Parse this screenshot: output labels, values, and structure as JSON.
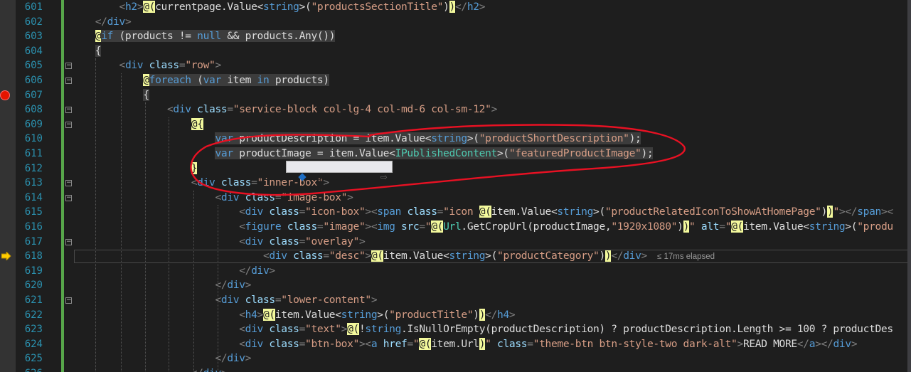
{
  "editor": {
    "line_numbers": [
      "601",
      "602",
      "603",
      "604",
      "605",
      "606",
      "607",
      "608",
      "609",
      "610",
      "611",
      "612",
      "613",
      "614",
      "615",
      "616",
      "617",
      "618",
      "619",
      "620",
      "621",
      "622",
      "623",
      "624",
      "625",
      "626"
    ],
    "lines": [
      [
        {
          "c": "t",
          "s": "        <"
        },
        {
          "c": "tag",
          "s": "h2"
        },
        {
          "c": "t",
          "s": ">"
        },
        {
          "c": "razor",
          "s": "@("
        },
        {
          "c": "id",
          "s": "currentpage.Value<"
        },
        {
          "c": "kw",
          "s": "string"
        },
        {
          "c": "id",
          "s": ">("
        },
        {
          "c": "str",
          "s": "\"productsSectionTitle\""
        },
        {
          "c": "id",
          "s": ")"
        },
        {
          "c": "razor",
          "s": ")"
        },
        {
          "c": "t",
          "s": "</"
        },
        {
          "c": "tag",
          "s": "h2"
        },
        {
          "c": "t",
          "s": ">"
        }
      ],
      [
        {
          "c": "t",
          "s": "    </"
        },
        {
          "c": "tag",
          "s": "div"
        },
        {
          "c": "t",
          "s": ">"
        }
      ],
      [
        {
          "c": "id",
          "s": "    "
        },
        {
          "c": "razor",
          "s": "@"
        },
        {
          "c": "kw",
          "s": "if",
          "hl": true
        },
        {
          "c": "id",
          "s": " (products != ",
          "hl": true
        },
        {
          "c": "kw",
          "s": "null",
          "hl": true
        },
        {
          "c": "id",
          "s": " && products.Any())",
          "hl": true
        }
      ],
      [
        {
          "c": "id",
          "s": "    "
        },
        {
          "c": "id",
          "s": "{",
          "hl": true
        }
      ],
      [
        {
          "c": "t",
          "s": "        <"
        },
        {
          "c": "tag",
          "s": "div"
        },
        {
          "c": "attr",
          "s": " class"
        },
        {
          "c": "t",
          "s": "="
        },
        {
          "c": "val",
          "s": "\"row\""
        },
        {
          "c": "t",
          "s": ">"
        }
      ],
      [
        {
          "c": "id",
          "s": "            "
        },
        {
          "c": "razor",
          "s": "@"
        },
        {
          "c": "kw",
          "s": "foreach",
          "hl": true
        },
        {
          "c": "id",
          "s": " (",
          "hl": true
        },
        {
          "c": "kw",
          "s": "var",
          "hl": true
        },
        {
          "c": "id",
          "s": " item ",
          "hl": true
        },
        {
          "c": "kw",
          "s": "in",
          "hl": true
        },
        {
          "c": "id",
          "s": " products)",
          "hl": true
        }
      ],
      [
        {
          "c": "id",
          "s": "            "
        },
        {
          "c": "id",
          "s": "{",
          "hl": true
        }
      ],
      [
        {
          "c": "t",
          "s": "                <"
        },
        {
          "c": "tag",
          "s": "div"
        },
        {
          "c": "attr",
          "s": " class"
        },
        {
          "c": "t",
          "s": "="
        },
        {
          "c": "val",
          "s": "\"service-block col-lg-4 col-md-6 col-sm-12\""
        },
        {
          "c": "t",
          "s": ">"
        }
      ],
      [
        {
          "c": "id",
          "s": "                    "
        },
        {
          "c": "razor",
          "s": "@{"
        }
      ],
      [
        {
          "c": "id",
          "s": "                        "
        },
        {
          "c": "kw",
          "s": "var",
          "hl": true
        },
        {
          "c": "id",
          "s": " productDescription = item.Value<",
          "hl": true
        },
        {
          "c": "kw",
          "s": "string",
          "hl": true
        },
        {
          "c": "id",
          "s": ">(",
          "hl": true
        },
        {
          "c": "str",
          "s": "\"productShortDescription\"",
          "hl": true
        },
        {
          "c": "id",
          "s": ");",
          "hl": true
        }
      ],
      [
        {
          "c": "id",
          "s": "                        "
        },
        {
          "c": "kw",
          "s": "var",
          "hl": true
        },
        {
          "c": "id",
          "s": " productImage = item.Value<",
          "hl": true
        },
        {
          "c": "type",
          "s": "IPublishedContent",
          "hl": true
        },
        {
          "c": "id",
          "s": ">(",
          "hl": true
        },
        {
          "c": "str",
          "s": "\"featuredProductImage\"",
          "hl": true
        },
        {
          "c": "id",
          "s": ");",
          "hl": true
        }
      ],
      [
        {
          "c": "id",
          "s": "                    "
        },
        {
          "c": "razor",
          "s": "}"
        }
      ],
      [
        {
          "c": "t",
          "s": "                    <"
        },
        {
          "c": "tag",
          "s": "div"
        },
        {
          "c": "attr",
          "s": " class"
        },
        {
          "c": "t",
          "s": "="
        },
        {
          "c": "val",
          "s": "\"inner-box\""
        },
        {
          "c": "t",
          "s": ">"
        }
      ],
      [
        {
          "c": "t",
          "s": "                        <"
        },
        {
          "c": "tag",
          "s": "div"
        },
        {
          "c": "attr",
          "s": " class"
        },
        {
          "c": "t",
          "s": "="
        },
        {
          "c": "val",
          "s": "\"image-box\""
        },
        {
          "c": "t",
          "s": ">"
        }
      ],
      [
        {
          "c": "t",
          "s": "                            <"
        },
        {
          "c": "tag",
          "s": "div"
        },
        {
          "c": "attr",
          "s": " class"
        },
        {
          "c": "t",
          "s": "="
        },
        {
          "c": "val",
          "s": "\"icon-box\""
        },
        {
          "c": "t",
          "s": "><"
        },
        {
          "c": "tag",
          "s": "span"
        },
        {
          "c": "attr",
          "s": " class"
        },
        {
          "c": "t",
          "s": "="
        },
        {
          "c": "val",
          "s": "\"icon "
        },
        {
          "c": "razor",
          "s": "@("
        },
        {
          "c": "id",
          "s": "item.Value<"
        },
        {
          "c": "kw",
          "s": "string"
        },
        {
          "c": "id",
          "s": ">("
        },
        {
          "c": "str",
          "s": "\"productRelatedIconToShowAtHomePage\""
        },
        {
          "c": "id",
          "s": ")"
        },
        {
          "c": "razor",
          "s": ")"
        },
        {
          "c": "val",
          "s": "\""
        },
        {
          "c": "t",
          "s": "></"
        },
        {
          "c": "tag",
          "s": "span"
        },
        {
          "c": "t",
          "s": "><"
        }
      ],
      [
        {
          "c": "t",
          "s": "                            <"
        },
        {
          "c": "tag",
          "s": "figure"
        },
        {
          "c": "attr",
          "s": " class"
        },
        {
          "c": "t",
          "s": "="
        },
        {
          "c": "val",
          "s": "\"image\""
        },
        {
          "c": "t",
          "s": "><"
        },
        {
          "c": "tag",
          "s": "img"
        },
        {
          "c": "attr",
          "s": " src"
        },
        {
          "c": "t",
          "s": "="
        },
        {
          "c": "val",
          "s": "\""
        },
        {
          "c": "razor",
          "s": "@("
        },
        {
          "c": "type",
          "s": "Url"
        },
        {
          "c": "id",
          "s": ".GetCropUrl(productImage,"
        },
        {
          "c": "str",
          "s": "\"1920x1080\""
        },
        {
          "c": "id",
          "s": ")"
        },
        {
          "c": "razor",
          "s": ")"
        },
        {
          "c": "val",
          "s": "\""
        },
        {
          "c": "attr",
          "s": " alt"
        },
        {
          "c": "t",
          "s": "="
        },
        {
          "c": "val",
          "s": "\""
        },
        {
          "c": "razor",
          "s": "@("
        },
        {
          "c": "id",
          "s": "item.Value<"
        },
        {
          "c": "kw",
          "s": "string"
        },
        {
          "c": "id",
          "s": ">("
        },
        {
          "c": "str",
          "s": "\"produ"
        }
      ],
      [
        {
          "c": "t",
          "s": "                            <"
        },
        {
          "c": "tag",
          "s": "div"
        },
        {
          "c": "attr",
          "s": " class"
        },
        {
          "c": "t",
          "s": "="
        },
        {
          "c": "val",
          "s": "\"overlay\""
        },
        {
          "c": "t",
          "s": ">"
        }
      ],
      [
        {
          "c": "t",
          "s": "                                <"
        },
        {
          "c": "tag",
          "s": "div"
        },
        {
          "c": "attr",
          "s": " class"
        },
        {
          "c": "t",
          "s": "="
        },
        {
          "c": "val",
          "s": "\"desc\""
        },
        {
          "c": "t",
          "s": ">"
        },
        {
          "c": "razor",
          "s": "@("
        },
        {
          "c": "id",
          "s": "item.Value<"
        },
        {
          "c": "kw",
          "s": "string"
        },
        {
          "c": "id",
          "s": ">("
        },
        {
          "c": "str",
          "s": "\"productCategory\""
        },
        {
          "c": "id",
          "s": ")"
        },
        {
          "c": "razor",
          "s": ")"
        },
        {
          "c": "t",
          "s": "</"
        },
        {
          "c": "tag",
          "s": "div"
        },
        {
          "c": "t",
          "s": ">"
        },
        {
          "c": "elapsed",
          "s": "≤ 17ms elapsed"
        }
      ],
      [
        {
          "c": "t",
          "s": "                            </"
        },
        {
          "c": "tag",
          "s": "div"
        },
        {
          "c": "t",
          "s": ">"
        }
      ],
      [
        {
          "c": "t",
          "s": "                        </"
        },
        {
          "c": "tag",
          "s": "div"
        },
        {
          "c": "t",
          "s": ">"
        }
      ],
      [
        {
          "c": "t",
          "s": "                        <"
        },
        {
          "c": "tag",
          "s": "div"
        },
        {
          "c": "attr",
          "s": " class"
        },
        {
          "c": "t",
          "s": "="
        },
        {
          "c": "val",
          "s": "\"lower-content\""
        },
        {
          "c": "t",
          "s": ">"
        }
      ],
      [
        {
          "c": "t",
          "s": "                            <"
        },
        {
          "c": "tag",
          "s": "h4"
        },
        {
          "c": "t",
          "s": ">"
        },
        {
          "c": "razor",
          "s": "@("
        },
        {
          "c": "id",
          "s": "item.Value<"
        },
        {
          "c": "kw",
          "s": "string"
        },
        {
          "c": "id",
          "s": ">("
        },
        {
          "c": "str",
          "s": "\"productTitle\""
        },
        {
          "c": "id",
          "s": ")"
        },
        {
          "c": "razor",
          "s": ")"
        },
        {
          "c": "t",
          "s": "</"
        },
        {
          "c": "tag",
          "s": "h4"
        },
        {
          "c": "t",
          "s": ">"
        }
      ],
      [
        {
          "c": "t",
          "s": "                            <"
        },
        {
          "c": "tag",
          "s": "div"
        },
        {
          "c": "attr",
          "s": " class"
        },
        {
          "c": "t",
          "s": "="
        },
        {
          "c": "val",
          "s": "\"text\""
        },
        {
          "c": "t",
          "s": ">"
        },
        {
          "c": "razor",
          "s": "@("
        },
        {
          "c": "id",
          "s": "!"
        },
        {
          "c": "kw",
          "s": "string"
        },
        {
          "c": "id",
          "s": ".IsNullOrEmpty(productDescription) ? productDescription.Length >= 100 ? productDes"
        }
      ],
      [
        {
          "c": "t",
          "s": "                            <"
        },
        {
          "c": "tag",
          "s": "div"
        },
        {
          "c": "attr",
          "s": " class"
        },
        {
          "c": "t",
          "s": "="
        },
        {
          "c": "val",
          "s": "\"btn-box\""
        },
        {
          "c": "t",
          "s": "><"
        },
        {
          "c": "tag",
          "s": "a"
        },
        {
          "c": "attr",
          "s": " href"
        },
        {
          "c": "t",
          "s": "="
        },
        {
          "c": "val",
          "s": "\""
        },
        {
          "c": "razor",
          "s": "@("
        },
        {
          "c": "id",
          "s": "item.Url"
        },
        {
          "c": "razor",
          "s": ")"
        },
        {
          "c": "val",
          "s": "\""
        },
        {
          "c": "attr",
          "s": " class"
        },
        {
          "c": "t",
          "s": "="
        },
        {
          "c": "val",
          "s": "\"theme-btn btn-style-two dark-alt\""
        },
        {
          "c": "t",
          "s": ">"
        },
        {
          "c": "id",
          "s": "READ MORE"
        },
        {
          "c": "t",
          "s": "</"
        },
        {
          "c": "tag",
          "s": "a"
        },
        {
          "c": "t",
          "s": "></"
        },
        {
          "c": "tag",
          "s": "div"
        },
        {
          "c": "t",
          "s": ">"
        }
      ],
      [
        {
          "c": "t",
          "s": "                        </"
        },
        {
          "c": "tag",
          "s": "div"
        },
        {
          "c": "t",
          "s": ">"
        }
      ],
      [
        {
          "c": "t",
          "s": "                    </"
        },
        {
          "c": "tag",
          "s": "div"
        },
        {
          "c": "t",
          "s": ">"
        }
      ]
    ],
    "folds": [
      "605",
      "606",
      "608",
      "609",
      "613",
      "614",
      "617",
      "621"
    ],
    "breakpoint_line": "607",
    "current_line": "618"
  },
  "datatip": {
    "name": "productImage",
    "value": "null"
  },
  "colors": {
    "background": "#1e1e1e",
    "line_number": "#2b91af",
    "breakpoint": "#e51400",
    "execution_arrow": "#ffcc00",
    "annotation": "#e81123",
    "razor_highlight": "#f3f99c"
  }
}
